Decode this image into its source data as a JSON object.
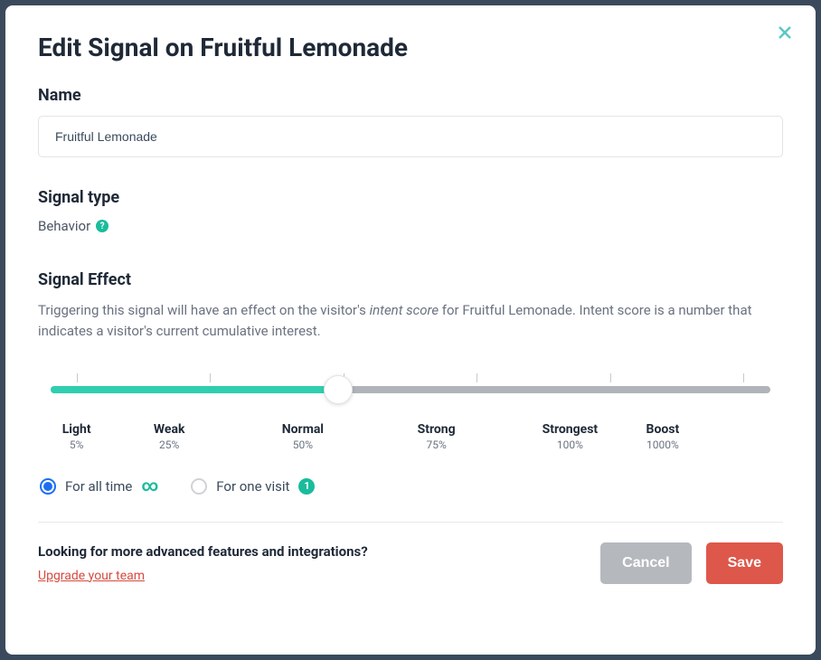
{
  "modal": {
    "title": "Edit Signal on Fruitful Lemonade",
    "name_label": "Name",
    "name_value": "Fruitful Lemonade",
    "signal_type_label": "Signal type",
    "signal_type_value": "Behavior",
    "effect_label": "Signal Effect",
    "effect_desc_pre": "Triggering this signal will have an effect on the visitor's ",
    "effect_desc_italic": "intent score",
    "effect_desc_post": " for Fruitful Lemonade. Intent score is a number that indicates a visitor's current cumulative interest."
  },
  "slider": {
    "value_index": 2,
    "stops": [
      {
        "name": "Light",
        "pct": "5%"
      },
      {
        "name": "Weak",
        "pct": "25%"
      },
      {
        "name": "Normal",
        "pct": "50%"
      },
      {
        "name": "Strong",
        "pct": "75%"
      },
      {
        "name": "Strongest",
        "pct": "100%"
      },
      {
        "name": "Boost",
        "pct": "1000%"
      }
    ]
  },
  "duration": {
    "selected": "all_time",
    "all_time_label": "For all time",
    "one_visit_label": "For one visit",
    "one_visit_badge": "1"
  },
  "footer": {
    "prompt": "Looking for more advanced features and integrations?",
    "upgrade_link": "Upgrade your team",
    "cancel": "Cancel",
    "save": "Save"
  }
}
